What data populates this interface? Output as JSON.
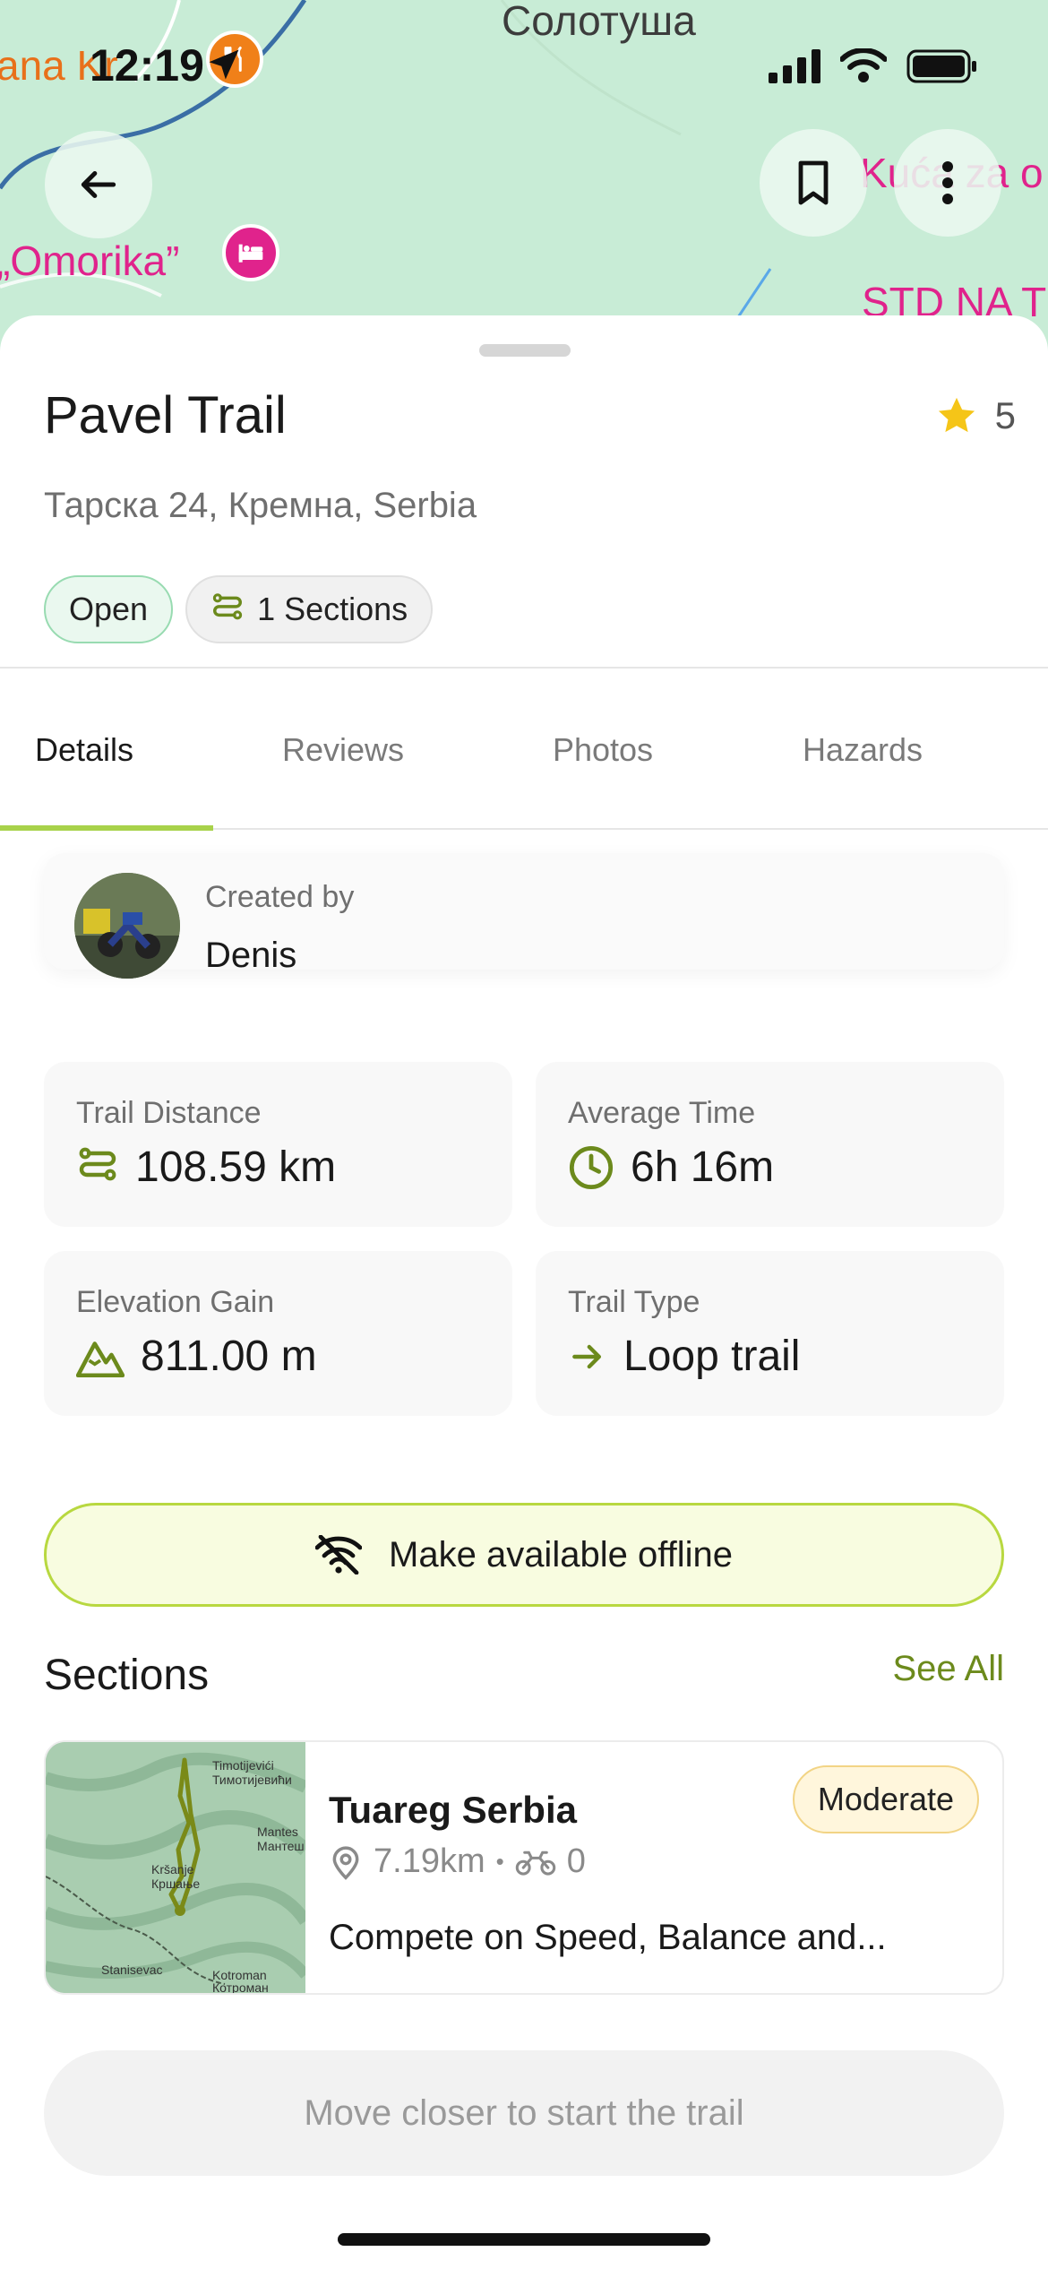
{
  "status_bar": {
    "time": "12:19"
  },
  "map": {
    "labels": {
      "top_center": "Солотуша",
      "top_left": "ana Kr",
      "left": "„Omorika”",
      "right": "Kuća za o",
      "bottom_right": "STD NA T"
    }
  },
  "header": {
    "back_icon": "arrow-left-icon",
    "bookmark_icon": "bookmark-icon",
    "more_icon": "more-vertical-icon"
  },
  "trail": {
    "name": "Pavel Trail",
    "rating": "5",
    "address": "Тарска 24, Кремна, Serbia",
    "status_chip": "Open",
    "sections_chip": "1 Sections"
  },
  "tabs": [
    {
      "label": "Details",
      "active": true
    },
    {
      "label": "Reviews",
      "active": false
    },
    {
      "label": "Photos",
      "active": false
    },
    {
      "label": "Hazards",
      "active": false
    }
  ],
  "creator": {
    "label": "Created by",
    "name": "Denis"
  },
  "stats": {
    "distance": {
      "label": "Trail Distance",
      "value": "108.59 km"
    },
    "time": {
      "label": "Average Time",
      "value": "6h 16m"
    },
    "elevation": {
      "label": "Elevation Gain",
      "value": "811.00 m"
    },
    "type": {
      "label": "Trail Type",
      "value": "Loop trail"
    }
  },
  "offline_button": "Make available offline",
  "sections": {
    "title": "Sections",
    "see_all": "See All",
    "items": [
      {
        "name": "Tuareg Serbia",
        "difficulty": "Moderate",
        "distance": "7.19km",
        "separator": "•",
        "riders": "0",
        "description": "Compete on Speed, Balance and...",
        "thumb_labels": [
          "Timotijevići",
          "Тимотијевићи",
          "Mantes",
          "Мантеш",
          "Kršanje",
          "Кршање",
          "Stanisevac",
          "Kotroman",
          "Котроман"
        ]
      }
    ]
  },
  "start_button": "Move closer to start the trail",
  "colors": {
    "accent_green": "#a8d24a",
    "icon_olive": "#6c8a1c",
    "open_chip_bg": "#eaf8ef",
    "moderate_chip_bg": "#fff6dc",
    "star": "#f5c518"
  }
}
